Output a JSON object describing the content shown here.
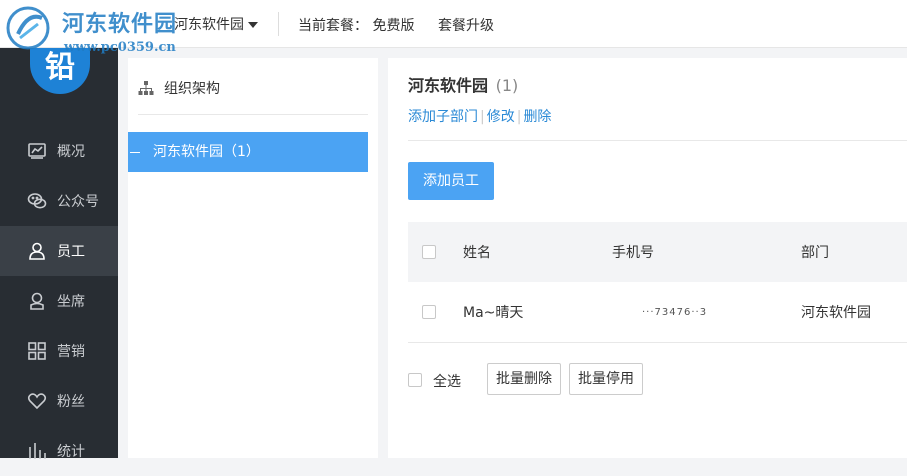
{
  "header": {
    "watermark_title": "河东软件园",
    "watermark_url": "www.pc0359.cn",
    "company_name": "河东软件园",
    "plan_label": "当前套餐：",
    "plan_value": "免费版",
    "upgrade_label": "套餐升级"
  },
  "sidebar": {
    "avatar_text": "铅",
    "items": [
      {
        "label": "概况",
        "icon": "chart-icon"
      },
      {
        "label": "公众号",
        "icon": "wechat-icon"
      },
      {
        "label": "员工",
        "icon": "user-icon",
        "active": true
      },
      {
        "label": "坐席",
        "icon": "seat-icon"
      },
      {
        "label": "营销",
        "icon": "grid-icon"
      },
      {
        "label": "粉丝",
        "icon": "heart-icon"
      },
      {
        "label": "统计",
        "icon": "stats-icon"
      }
    ]
  },
  "tree": {
    "title": "组织架构",
    "node": "河东软件园（1）"
  },
  "main": {
    "dept_name": "河东软件园",
    "dept_count": "(1)",
    "actions": [
      "添加子部门",
      "修改",
      "删除"
    ],
    "add_button": "添加员工",
    "columns": [
      "姓名",
      "手机号",
      "部门"
    ],
    "rows": [
      {
        "name": "Ma~晴天",
        "phone": "···73476··3",
        "dept": "河东软件园"
      }
    ],
    "select_all": "全选",
    "batch_delete": "批量删除",
    "batch_disable": "批量停用"
  },
  "colors": {
    "accent": "#4ba3f3",
    "sidebar_bg": "#282d33",
    "link": "#2b8ad6"
  }
}
